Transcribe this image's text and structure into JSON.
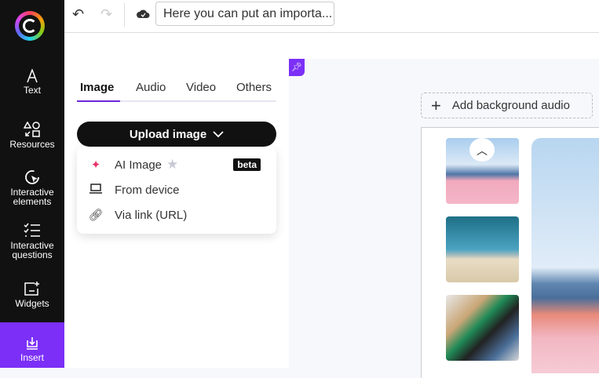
{
  "sidebar": {
    "items": [
      {
        "label": "Text"
      },
      {
        "label": "Resources"
      },
      {
        "label": "Interactive elements"
      },
      {
        "label": "Interactive questions"
      },
      {
        "label": "Widgets"
      },
      {
        "label": "Insert"
      }
    ]
  },
  "topbar": {
    "notice_value": "Here you can put an importa..."
  },
  "panel": {
    "tabs": [
      "Image",
      "Audio",
      "Video",
      "Others"
    ],
    "upload_label": "Upload image",
    "menu": [
      {
        "label": "AI Image",
        "badge": "beta"
      },
      {
        "label": "From device"
      },
      {
        "label": "Via link (URL)"
      }
    ]
  },
  "canvas": {
    "add_audio_label": "Add background audio"
  },
  "colors": {
    "accent": "#7b2ff7",
    "sidebar": "#111111"
  }
}
